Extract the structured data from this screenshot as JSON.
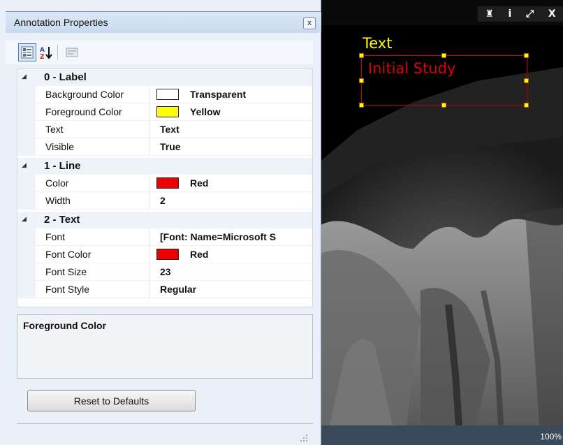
{
  "panel": {
    "title": "Annotation Properties",
    "close_glyph": "x",
    "toolbar": {
      "categorized_icon": "categorized-view-icon",
      "alphabetical_icon": "sort-alphabetical-icon",
      "property_pages_icon": "property-pages-icon"
    },
    "categories": [
      {
        "label": "0 - Label",
        "properties": [
          {
            "name": "Background Color",
            "value": "Transparent",
            "swatch": "#ffffff"
          },
          {
            "name": "Foreground Color",
            "value": "Yellow",
            "swatch": "#ffff00"
          },
          {
            "name": "Text",
            "value": "Text"
          },
          {
            "name": "Visible",
            "value": "True"
          }
        ]
      },
      {
        "label": "1 - Line",
        "properties": [
          {
            "name": "Color",
            "value": "Red",
            "swatch": "#ee0000"
          },
          {
            "name": "Width",
            "value": "2"
          }
        ]
      },
      {
        "label": "2 - Text",
        "properties": [
          {
            "name": "Font",
            "value": "[Font: Name=Microsoft S"
          },
          {
            "name": "Font Color",
            "value": "Red",
            "swatch": "#ee0000"
          },
          {
            "name": "Font Size",
            "value": "23"
          },
          {
            "name": "Font Style",
            "value": "Regular"
          }
        ]
      }
    ],
    "description_title": "Foreground Color",
    "reset_button": "Reset to Defaults"
  },
  "viewer": {
    "toolbar_glyphs": [
      "♜",
      "i",
      "⤢",
      "X"
    ],
    "annotation_label": "Text",
    "annotation_text": "Initial Study",
    "zoom": "100%"
  }
}
